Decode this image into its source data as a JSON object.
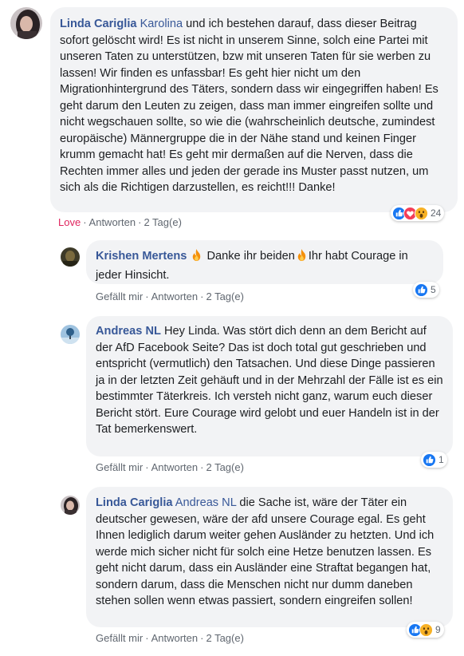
{
  "comments": [
    {
      "author": "Linda Cariglia",
      "mention": "Karolina",
      "text": " und ich bestehen darauf, dass dieser Beitrag sofort gelöscht wird! Es ist nicht in unserem Sinne, solch eine Partei mit unseren Taten zu unterstützen, bzw mit unseren Taten für sie werben zu lassen! Wir finden es unfassbar! Es geht hier nicht um den Migrationhintergrund des Täters, sondern dass wir eingegriffen haben! Es geht darum den Leuten zu zeigen, dass man immer eingreifen sollte und nicht wegschauen sollte, so wie die (wahrscheinlich deutsche, zumindest europäische) Männergruppe die in der Nähe stand und keinen Finger krumm gemacht hat! Es geht mir dermaßen auf die Nerven, dass die Rechten immer alles und jeden der gerade ins Muster passt nutzen, um sich als die Richtigen darzustellen, es reicht!!! Danke!",
      "action_like": "Love",
      "action_reply": "Antworten",
      "time": "2 Tag(e)",
      "reaction_count": "24",
      "reaction_icons": [
        "like-icon",
        "love-icon",
        "wow-icon"
      ]
    },
    {
      "author": "Krishen Mertens",
      "text_before": " Danke ihr beiden",
      "text_after": "Ihr habt Courage in jeder Hinsicht.",
      "action_like": "Gefällt mir",
      "action_reply": "Antworten",
      "time": "2 Tag(e)",
      "reaction_count": "5",
      "reaction_icons": [
        "like-icon"
      ]
    },
    {
      "author": "Andreas NL",
      "text": " Hey Linda. Was stört dich denn an dem Bericht auf der AfD Facebook Seite? Das ist doch total gut geschrieben und entspricht (vermutlich) den Tatsachen. Und diese Dinge passieren ja in der letzten Zeit gehäuft und in der Mehrzahl der Fälle ist es ein bestimmter Täterkreis. Ich versteh nicht ganz, warum euch dieser Bericht stört. Eure Courage wird gelobt und euer Handeln ist in der Tat bemerkenswert.",
      "action_like": "Gefällt mir",
      "action_reply": "Antworten",
      "time": "2 Tag(e)",
      "reaction_count": "1",
      "reaction_icons": [
        "like-icon"
      ]
    },
    {
      "author": "Linda Cariglia",
      "mention": "Andreas NL",
      "text": " die Sache ist, wäre der Täter ein deutscher gewesen, wäre der afd unsere Courage egal. Es geht Ihnen lediglich darum weiter gehen Ausländer zu hetzten. Und ich werde mich sicher nicht für solch eine Hetze benutzen lassen. Es geht nicht darum, dass ein Ausländer eine Straftat begangen hat, sondern darum, dass die Menschen nicht nur dumm daneben stehen sollen wenn etwas passiert, sondern eingreifen sollen!",
      "action_like": "Gefällt mir",
      "action_reply": "Antworten",
      "time": "2 Tag(e)",
      "reaction_count": "9",
      "reaction_icons": [
        "like-icon",
        "wow-icon"
      ]
    }
  ],
  "separator": "·",
  "colors": {
    "link": "#385898",
    "love": "#e0245e",
    "bubble": "#f2f3f5",
    "like_blue": "#1877f2",
    "love_red": "#f33e58",
    "wow_yellow": "#f7b125"
  }
}
